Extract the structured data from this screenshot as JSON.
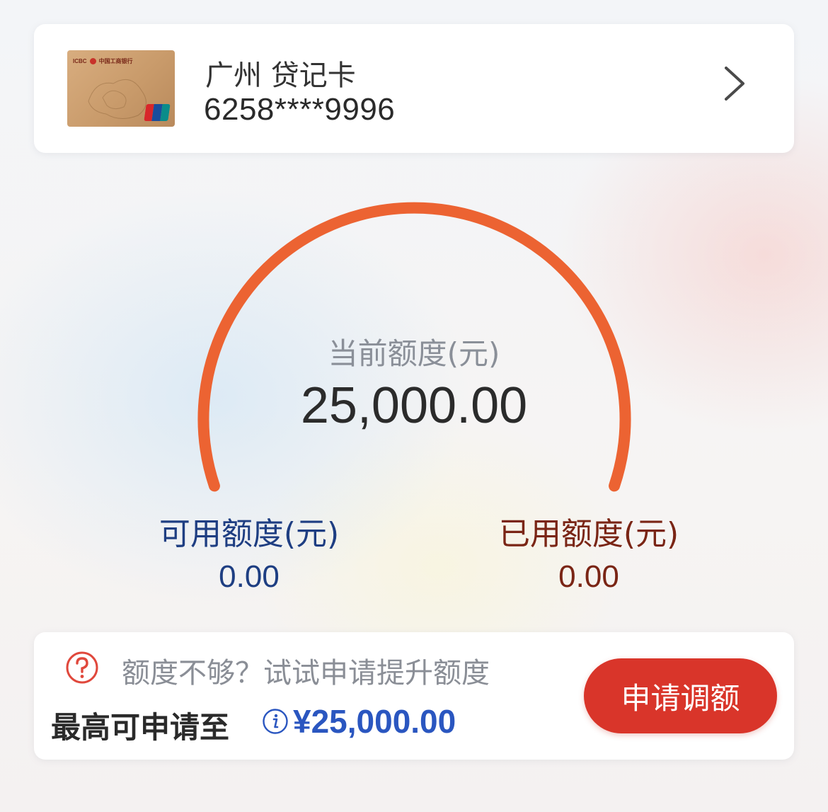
{
  "card": {
    "bank_abbr": "ICBC",
    "bank_name": "中国工商银行",
    "name": "广州 贷记卡",
    "number": "6258****9996"
  },
  "limit": {
    "current_label": "当前额度(元)",
    "current_value": "25,000.00",
    "available_label": "可用额度(元)",
    "available_value": "0.00",
    "used_label": "已用额度(元)",
    "used_value": "0.00"
  },
  "raise": {
    "hint": "额度不够？试试申请提升额度",
    "max_label": "最高可申请至",
    "max_value": "¥25,000.00",
    "button_label": "申请调额"
  },
  "colors": {
    "gauge_arc": "#ec6332",
    "button": "#d9352a",
    "available_text": "#1e3e82",
    "used_text": "#7a2515",
    "max_value_text": "#2a56c0"
  }
}
